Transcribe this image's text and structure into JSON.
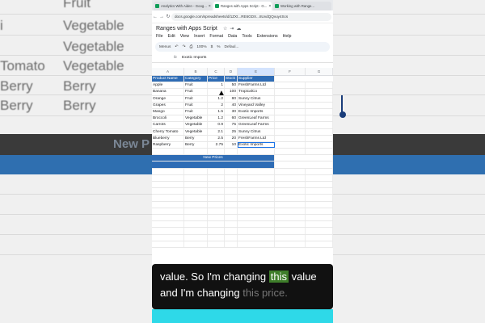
{
  "background": {
    "left_cells": [
      {
        "row": 0,
        "text": "Fruit"
      },
      {
        "row": 1,
        "text": "i"
      },
      {
        "row": 2,
        "text": "Vegetable"
      },
      {
        "row": 3,
        "text": "Tomato"
      },
      {
        "row": 4,
        "text": "Berry"
      },
      {
        "row": 5,
        "text": "Berry"
      }
    ],
    "middle_cells": [
      "Vegetable",
      "Vegetable",
      "Vegetable",
      "Berry",
      "Berry"
    ],
    "band_text": "New P"
  },
  "browser": {
    "tabs": [
      {
        "title": "Analytics With Aiden - Goog...",
        "active": false
      },
      {
        "title": "Ranges with Apps Script - G...",
        "active": true
      },
      {
        "title": "Working with Range...",
        "active": false
      }
    ],
    "url": "docs.google.com/spreadsheets/d/1ZXt...RE6GDX...8UvdQQvuy4Scs"
  },
  "sheet": {
    "title": "Ranges with Apps Script",
    "menus": [
      "File",
      "Edit",
      "View",
      "Insert",
      "Format",
      "Data",
      "Tools",
      "Extensions",
      "Help"
    ],
    "toolbar": {
      "menus_label": "Menus",
      "zoom": "100%",
      "font": "Defaul..."
    },
    "namebox": "",
    "formula": "Exotic Imports",
    "columns": [
      "A",
      "B",
      "C",
      "D",
      "E",
      "F",
      "G"
    ],
    "headers": [
      "Product Name",
      "Category",
      "Price",
      "Stock",
      "Supplier"
    ],
    "rows": [
      [
        "Apple",
        "Fruit",
        "1",
        "50",
        "FreshFarms Ltd"
      ],
      [
        "Banana",
        "Fruit",
        "",
        "100",
        "TropicalCo"
      ],
      [
        "Orange",
        "Fruit",
        "1.2",
        "80",
        "Sunny Citrus"
      ],
      [
        "Grapes",
        "Fruit",
        "2",
        "40",
        "Vineyard Valley"
      ],
      [
        "Mango",
        "Fruit",
        "1.5",
        "30",
        "Exotic Imports"
      ],
      [
        "Broccoli",
        "Vegetable",
        "1.2",
        "60",
        "GreenLeaf Farms"
      ],
      [
        "Carrots",
        "Vegetable",
        "0.9",
        "75",
        "GreenLeaf Farms"
      ],
      [
        "Cherry Tomato",
        "Vegetable",
        "2.1",
        "25",
        "Sunny Citrus"
      ],
      [
        "Blueberry",
        "Berry",
        "2.5",
        "20",
        "FreshFarms Ltd"
      ],
      [
        "Raspberry",
        "Berry",
        "2.75",
        "10",
        "Exotic Imports"
      ]
    ],
    "band_label": "New Prices"
  },
  "caption": {
    "line1_a": "value. So I'm changing ",
    "line1_hl": "this",
    "line1_b": " value",
    "line2_a": "and I'm changing ",
    "line2_dim": "this price."
  },
  "colors": {
    "header_blue": "#2e6cb5",
    "highlight_green": "#3e7d2a",
    "cyan": "#2ed9e8"
  }
}
